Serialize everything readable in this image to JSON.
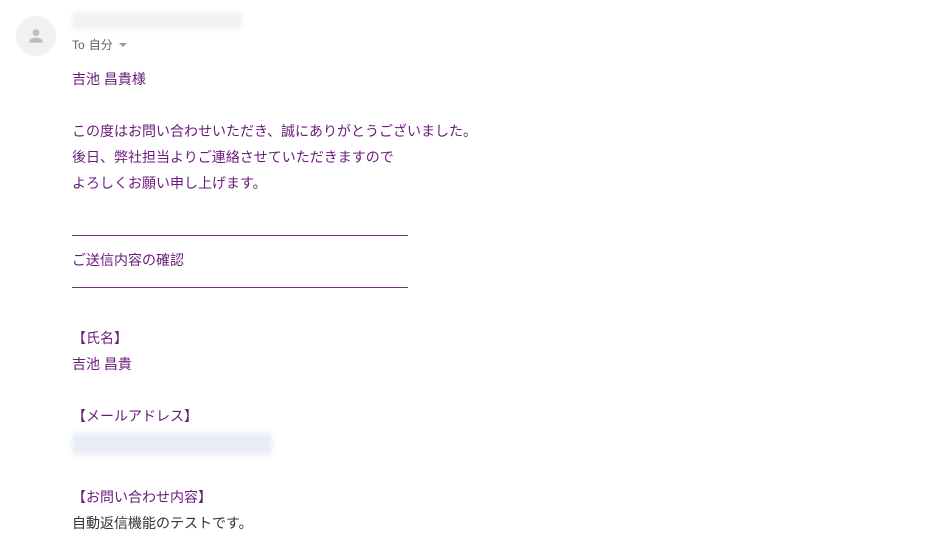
{
  "header": {
    "to_label": "To",
    "to_recipient": "自分"
  },
  "body": {
    "greeting": "吉池 昌貴様",
    "thanks": "この度はお問い合わせいただき、誠にありがとうございました。",
    "followup1": "後日、弊社担当よりご連絡させていただきますので",
    "followup2": "よろしくお願い申し上げます。",
    "divider": "――――――――――――――――――――――――",
    "confirm_title": "ご送信内容の確認",
    "field_name_label": "【氏名】",
    "field_name_value": "吉池 昌貴",
    "field_email_label": "【メールアドレス】",
    "field_inquiry_label": "【お問い合わせ内容】",
    "field_inquiry_value": "自動返信機能のテストです。"
  }
}
